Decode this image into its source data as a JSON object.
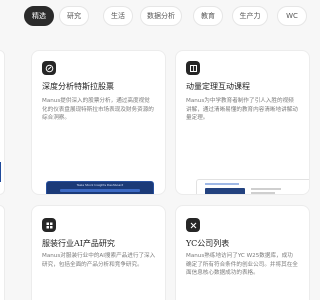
{
  "tabs": [
    {
      "label": "精选",
      "active": true
    },
    {
      "label": "研究",
      "active": false
    },
    {
      "label": "生活",
      "active": false
    },
    {
      "label": "数据分析",
      "active": false
    },
    {
      "label": "教育",
      "active": false
    },
    {
      "label": "生产力",
      "active": false
    },
    {
      "label": "WC",
      "active": false
    }
  ],
  "cards": [
    {
      "title": "深度分析特斯拉股票",
      "description": "Manus提供深入的股票分析，通过高度视觉化的仪表盘展现特斯拉市场表现及财务资源的综合洞察。",
      "icon": "chart-icon",
      "preview": {
        "heading": "Tesla Stock Insights Dashboard"
      }
    },
    {
      "title": "动量定理互动课程",
      "description": "Manus为中学教育者制作了引人入胜的视频讲解，通过清晰易懂的教育内容清晰地讲解动量定理。",
      "icon": "book-icon",
      "preview": {
        "heading": ""
      }
    },
    {
      "title": "服装行业AI产品研究",
      "description": "Manus对服装行业中的AI搜索产品进行了深入研究，包括全面的产品分析和竞争研究。",
      "icon": "grid-icon",
      "preview": {
        "heading": ""
      }
    },
    {
      "title": "YC公司列表",
      "description": "Manus熟练地访问了YC W25数据库，成功确定了所有符合条件的创业公司。并将其在全面信息核心数据成功的表格。",
      "icon": "globe-icon",
      "preview": {
        "heading": ""
      }
    }
  ],
  "colors": {
    "accent": "#2b2b2b",
    "chip_teal": "#17a2a8",
    "chip_blue": "#2d6fd6"
  }
}
